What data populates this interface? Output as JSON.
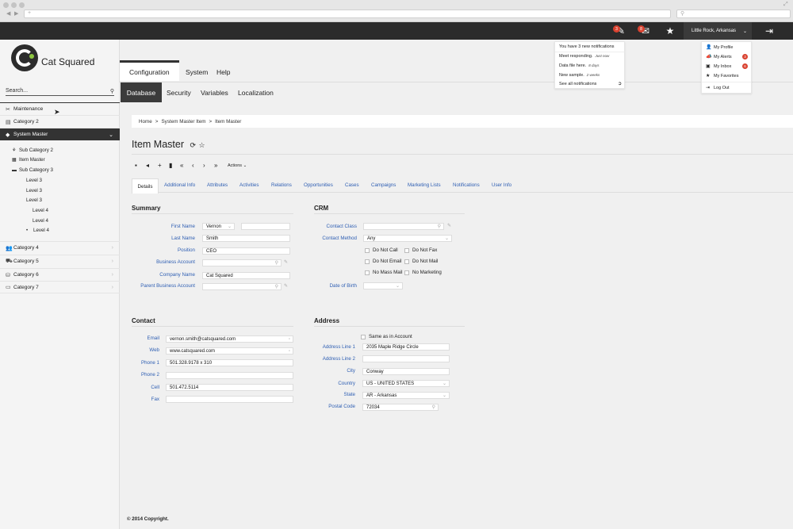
{
  "browser": {
    "search_placeholder": ""
  },
  "topbar": {
    "notif_count": "3",
    "mail_count": "8",
    "location": "Little Rock, Arkansas"
  },
  "notifications": {
    "header": "You have 3 new notifications",
    "items": [
      {
        "text": "Meet responding.",
        "time": "Just now"
      },
      {
        "text": "Data file here.",
        "time": "8 days"
      },
      {
        "text": "New sample.",
        "time": "2 weeks"
      }
    ],
    "see_all": "See all notifications"
  },
  "profile_menu": {
    "items": [
      {
        "label": "My Profile",
        "badge": ""
      },
      {
        "label": "My Alerts",
        "badge": "3"
      },
      {
        "label": "My Inbox",
        "badge": "6"
      },
      {
        "label": "My Favorites",
        "badge": ""
      },
      {
        "label": "Log Out",
        "badge": ""
      }
    ]
  },
  "brand": {
    "name": "Cat Squared"
  },
  "search": {
    "placeholder": "Search..."
  },
  "sidebar": {
    "items": [
      {
        "label": "Maintenance"
      },
      {
        "label": "Category 2"
      },
      {
        "label": "System Master"
      },
      {
        "label": "Category 4"
      },
      {
        "label": "Category 5"
      },
      {
        "label": "Category 6"
      },
      {
        "label": "Category 7"
      }
    ],
    "sub": [
      {
        "label": "Sub Category 2"
      },
      {
        "label": "Item Master"
      },
      {
        "label": "Sub Category 3"
      },
      {
        "label": "Level 3"
      },
      {
        "label": "Level 3"
      },
      {
        "label": "Level 3"
      },
      {
        "label": "Level 4"
      },
      {
        "label": "Level 4"
      },
      {
        "label": "Level 4"
      }
    ]
  },
  "nav1": [
    "Configuration",
    "System",
    "Help"
  ],
  "nav2": [
    "Database",
    "Security",
    "Variables",
    "Localization"
  ],
  "breadcrumb": {
    "home": "Home",
    "sep": ">",
    "parent": "System Master Item",
    "current": "Item Master"
  },
  "page_title": "Item Master",
  "toolbar": {
    "actions": "Actions"
  },
  "tabs": [
    "Details",
    "Additional Info",
    "Attributes",
    "Activities",
    "Relations",
    "Opportunities",
    "Cases",
    "Campaigns",
    "Marketing Lists",
    "Notifications",
    "User Info"
  ],
  "summary": {
    "title": "Summary",
    "first_name_label": "First Name",
    "first_name": "Vernon",
    "last_name_label": "Last Name",
    "last_name": "Smith",
    "position_label": "Position",
    "position": "CEO",
    "business_account_label": "Business Account",
    "business_account": "",
    "company_name_label": "Company Name",
    "company_name": "Cat Squared",
    "parent_business_account_label": "Parent Business Account",
    "parent_business_account": ""
  },
  "crm": {
    "title": "CRM",
    "contact_class_label": "Contact Class",
    "contact_class": "",
    "contact_method_label": "Contact Method",
    "contact_method": "Any",
    "checks": [
      "Do Not Call",
      "Do Not Fax",
      "Do Not Email",
      "Do Not Mail",
      "No Mass Mail",
      "No Marketing"
    ],
    "dob_label": "Date of Birth",
    "dob": ""
  },
  "contact": {
    "title": "Contact",
    "email_label": "Email",
    "email": "vernon.smith@catsquared.com",
    "web_label": "Web",
    "web": "www.catsquared.com",
    "phone1_label": "Phone 1",
    "phone1": "501.328.9178 x 310",
    "phone2_label": "Phone 2",
    "phone2": "",
    "cell_label": "Cell",
    "cell": "501.472.5114",
    "fax_label": "Fax",
    "fax": ""
  },
  "address": {
    "title": "Address",
    "same_as": "Same as in Account",
    "line1_label": "Address Line 1",
    "line1": "2035 Maple Ridge Circle",
    "line2_label": "Address Line 2",
    "line2": "",
    "city_label": "City",
    "city": "Conway",
    "country_label": "Country",
    "country": "US - UNITED STATES",
    "state_label": "State",
    "state": "AR - Arkansas",
    "postal_label": "Postal Code",
    "postal": "72034"
  },
  "footer": "© 2014 Copyright."
}
